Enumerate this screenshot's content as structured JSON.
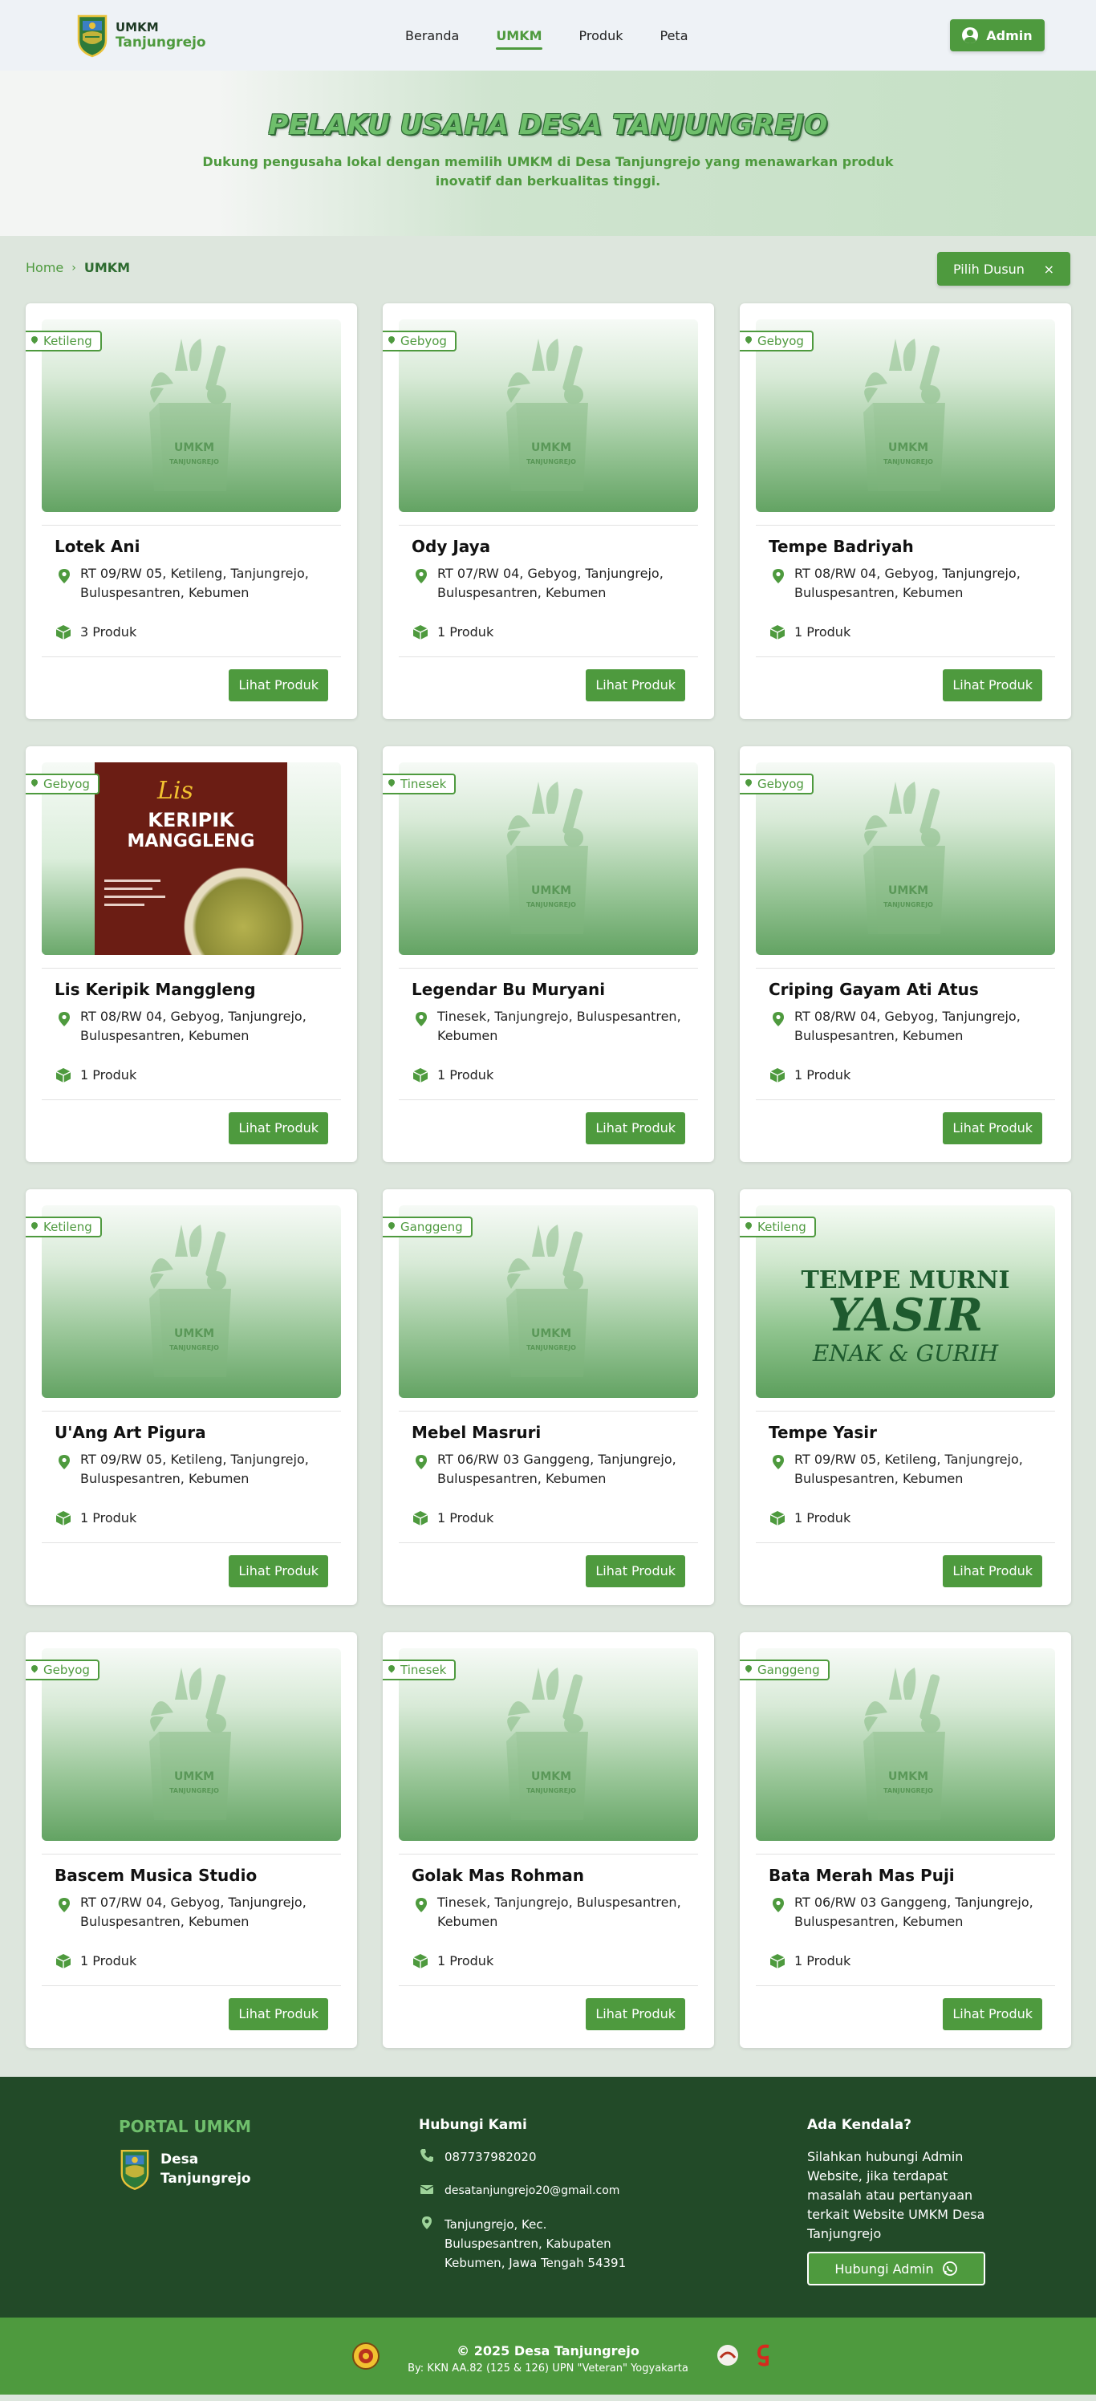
{
  "navbar": {
    "brand_line1": "UMKM",
    "brand_line2": "Tanjungrejo",
    "links": [
      {
        "label": "Beranda",
        "active": false
      },
      {
        "label": "UMKM",
        "active": true
      },
      {
        "label": "Produk",
        "active": false
      },
      {
        "label": "Peta",
        "active": false
      }
    ],
    "admin_label": "Admin"
  },
  "hero": {
    "title": "PELAKU USAHA DESA TANJUNGREJO",
    "subtitle": "Dukung pengusaha lokal dengan memilih UMKM di Desa Tanjungrejo yang menawarkan produk inovatif dan berkualitas tinggi."
  },
  "breadcrumb": {
    "home": "Home",
    "separator": "›",
    "current": "UMKM"
  },
  "filter": {
    "label": "Pilih Dusun",
    "clear": "×"
  },
  "placeholder_image": {
    "line1": "UMKM",
    "line2": "TANJUNGREJO"
  },
  "cards": [
    {
      "tag": "Ketileng",
      "name": "Lotek Ani",
      "address": "RT 09/RW 05, Ketileng, Tanjungrejo, Buluspesantren, Kebumen",
      "count": "3 Produk",
      "button": "Lihat Produk"
    },
    {
      "tag": "Gebyog",
      "name": "Ody Jaya",
      "address": "RT 07/RW 04, Gebyog, Tanjungrejo, Buluspesantren, Kebumen",
      "count": "1 Produk",
      "button": "Lihat Produk"
    },
    {
      "tag": "Gebyog",
      "name": "Tempe Badriyah",
      "address": "RT 08/RW 04, Gebyog, Tanjungrejo, Buluspesantren, Kebumen",
      "count": "1 Produk",
      "button": "Lihat Produk"
    },
    {
      "tag": "Gebyog",
      "name": "Lis Keripik Manggleng",
      "address": "RT 08/RW 04, Gebyog, Tanjungrejo, Buluspesantren, Kebumen",
      "count": "1 Produk",
      "button": "Lihat Produk"
    },
    {
      "tag": "Tinesek",
      "name": "Legendar Bu Muryani",
      "address": "Tinesek, Tanjungrejo, Buluspesantren, Kebumen",
      "count": "1 Produk",
      "button": "Lihat Produk"
    },
    {
      "tag": "Gebyog",
      "name": "Criping Gayam Ati Atus",
      "address": "RT 08/RW 04, Gebyog, Tanjungrejo, Buluspesantren, Kebumen",
      "count": "1 Produk",
      "button": "Lihat Produk"
    },
    {
      "tag": "Ketileng",
      "name": "U'Ang Art Pigura",
      "address": "RT 09/RW 05, Ketileng, Tanjungrejo, Buluspesantren, Kebumen",
      "count": "1 Produk",
      "button": "Lihat Produk"
    },
    {
      "tag": "Ganggeng",
      "name": "Mebel Masruri",
      "address": "RT 06/RW 03 Ganggeng, Tanjungrejo, Buluspesantren, Kebumen",
      "count": "1 Produk",
      "button": "Lihat Produk"
    },
    {
      "tag": "Ketileng",
      "name": "Tempe Yasir",
      "address": "RT 09/RW 05, Ketileng, Tanjungrejo, Buluspesantren, Kebumen",
      "count": "1 Produk",
      "button": "Lihat Produk"
    },
    {
      "tag": "Gebyog",
      "name": "Bascem Musica Studio",
      "address": "RT 07/RW 04, Gebyog, Tanjungrejo, Buluspesantren, Kebumen",
      "count": "1 Produk",
      "button": "Lihat Produk"
    },
    {
      "tag": "Tinesek",
      "name": "Golak Mas Rohman",
      "address": "Tinesek, Tanjungrejo, Buluspesantren, Kebumen",
      "count": "1 Produk",
      "button": "Lihat Produk"
    },
    {
      "tag": "Ganggeng",
      "name": "Bata Merah Mas Puji",
      "address": "RT 06/RW 03 Ganggeng, Tanjungrejo, Buluspesantren, Kebumen",
      "count": "1 Produk",
      "button": "Lihat Produk"
    }
  ],
  "product_images": {
    "keripik": {
      "line1": "Lis",
      "line2": "KERIPIK",
      "line3": "MANGGLENG"
    },
    "tempe": {
      "line1": "TEMPE MURNI",
      "line2": "YASIR",
      "line3": "ENAK & GURIH"
    }
  },
  "footer": {
    "portal": "PORTAL UMKM",
    "village_line1": "Desa",
    "village_line2": "Tanjungrejo",
    "contact_heading": "Hubungi Kami",
    "phone": "087737982020",
    "email": "desatanjungrejo20@gmail.com",
    "address": "Tanjungrejo, Kec. Buluspesantren, Kabupaten Kebumen, Jawa Tengah 54391",
    "issue_heading": "Ada Kendala?",
    "issue_text": "Silahkan hubungi Admin Website, jika terdapat masalah atau pertanyaan terkait Website UMKM Desa Tanjungrejo",
    "contact_button": "Hubungi Admin",
    "copyright": "© 2025 Desa Tanjungrejo",
    "credit": "By: KKN AA.82 (125 & 126) UPN \"Veteran\" Yogyakarta"
  },
  "colors": {
    "primary": "#4e9a3e",
    "dark_green": "#224a28",
    "background": "#dde6dd"
  }
}
